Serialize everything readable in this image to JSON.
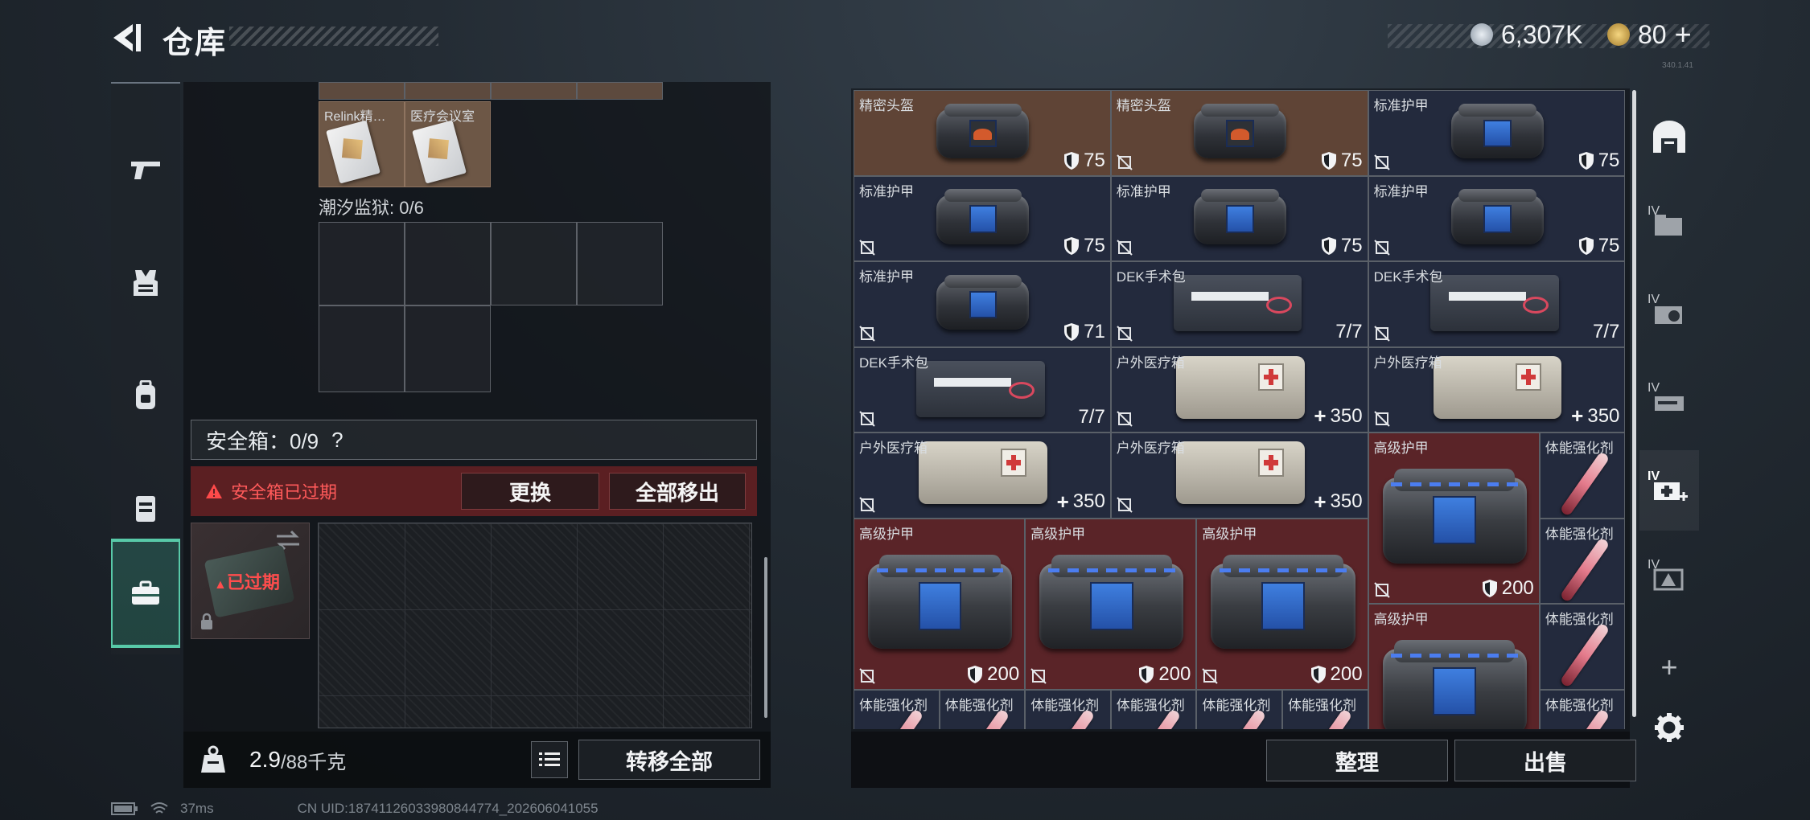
{
  "header": {
    "title": "仓库",
    "coins": "6,307K",
    "tokens": "80",
    "tokens_plus": "+",
    "version": "340.1.41"
  },
  "left_nav": {
    "items": [
      {
        "name": "weapons-icon"
      },
      {
        "name": "armor-vest-icon"
      },
      {
        "name": "backpack-icon"
      },
      {
        "name": "rig-icon"
      },
      {
        "name": "secure-container-icon"
      }
    ]
  },
  "keycards": {
    "items": [
      {
        "name": "Relink精…"
      },
      {
        "name": "医疗会议室"
      }
    ]
  },
  "tide_prison": {
    "label": "潮汐监狱: 0/6"
  },
  "safe_box": {
    "label": "安全箱：0/9",
    "help": "?",
    "expired_warning": "安全箱已过期",
    "replace_label": "更换",
    "move_all_label": "全部移出",
    "expired_tag": "已过期"
  },
  "bottom_left": {
    "weight": "2.9",
    "weight_max": "/88千克",
    "transfer_all_label": "转移全部"
  },
  "inventory": {
    "cells": [
      {
        "name": "精密头盔",
        "value": "75",
        "type": "helmet",
        "bg": "brown"
      },
      {
        "name": "精密头盔",
        "value": "75",
        "type": "helmet",
        "bg": "brown"
      },
      {
        "name": "标准护甲",
        "value": "75",
        "type": "armor",
        "bg": "navy"
      },
      {
        "name": "标准护甲",
        "value": "75",
        "type": "armor",
        "bg": "navy"
      },
      {
        "name": "标准护甲",
        "value": "75",
        "type": "armor",
        "bg": "navy"
      },
      {
        "name": "标准护甲",
        "value": "75",
        "type": "armor",
        "bg": "navy"
      },
      {
        "name": "标准护甲",
        "value": "71",
        "type": "armor",
        "bg": "navy"
      },
      {
        "name": "DEK手术包",
        "value": "7/7",
        "type": "surgery",
        "bg": "navy"
      },
      {
        "name": "DEK手术包",
        "value": "7/7",
        "type": "surgery",
        "bg": "navy"
      },
      {
        "name": "DEK手术包",
        "value": "7/7",
        "type": "surgery",
        "bg": "navy"
      },
      {
        "name": "户外医疗箱",
        "value": "350",
        "type": "medbox",
        "bg": "navy"
      },
      {
        "name": "户外医疗箱",
        "value": "350",
        "type": "medbox",
        "bg": "navy"
      },
      {
        "name": "户外医疗箱",
        "value": "350",
        "type": "medbox",
        "bg": "navy"
      },
      {
        "name": "户外医疗箱",
        "value": "350",
        "type": "medbox",
        "bg": "navy"
      },
      {
        "name": "高级护甲",
        "value": "200",
        "type": "bigarmor",
        "bg": "red"
      },
      {
        "name": "体能强化剂",
        "value": "",
        "type": "syringe",
        "bg": "navy"
      },
      {
        "name": "体能强化剂",
        "value": "",
        "type": "syringe",
        "bg": "navy"
      },
      {
        "name": "高级护甲",
        "value": "200",
        "type": "bigarmor",
        "bg": "red"
      },
      {
        "name": "高级护甲",
        "value": "200",
        "type": "bigarmor",
        "bg": "red"
      },
      {
        "name": "高级护甲",
        "value": "200",
        "type": "bigarmor",
        "bg": "red"
      },
      {
        "name": "高级护甲",
        "value": "",
        "type": "bigarmor",
        "bg": "red"
      },
      {
        "name": "体能强化剂",
        "value": "",
        "type": "syringe",
        "bg": "navy"
      },
      {
        "name": "体能强化剂",
        "value": "",
        "type": "syringe",
        "bg": "navy"
      },
      {
        "name": "体能强化剂",
        "value": "",
        "type": "syringe",
        "bg": "navy"
      },
      {
        "name": "体能强化剂",
        "value": "",
        "type": "syringe",
        "bg": "navy"
      },
      {
        "name": "体能强化剂",
        "value": "",
        "type": "syringe",
        "bg": "navy"
      },
      {
        "name": "体能强化剂",
        "value": "",
        "type": "syringe",
        "bg": "navy"
      },
      {
        "name": "体能强化剂",
        "value": "",
        "type": "syringe",
        "bg": "navy"
      },
      {
        "name": "体能强化剂",
        "value": "",
        "type": "syringe",
        "bg": "navy"
      }
    ]
  },
  "bottom_right": {
    "sort_label": "整理",
    "sell_label": "出售"
  },
  "right_rail": {
    "tier_label": "IV",
    "add": "+"
  },
  "status_bar": {
    "ping": "37ms",
    "uid": "CN UID:18741126033980844774_202606041055"
  }
}
